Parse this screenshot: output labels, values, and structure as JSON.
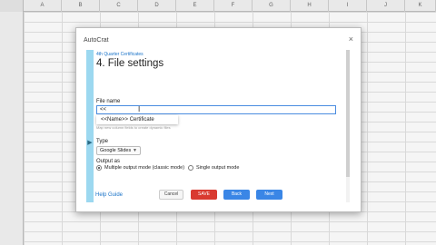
{
  "sheet": {
    "columns": [
      "A",
      "B",
      "C",
      "D",
      "E",
      "F",
      "G",
      "H",
      "I",
      "J",
      "K",
      "L"
    ]
  },
  "dialog": {
    "title": "AutoCrat",
    "close_glyph": "×",
    "breadcrumb": "4th Quarter Certificates",
    "heading": "4. File settings",
    "file_name_label": "File name",
    "file_name_value": "<<",
    "suggestion": "<<Name>> Certificate",
    "helper_text": "Map new column fields to create dynamic files",
    "type_label": "Type",
    "type_value": "Google Slides",
    "output_label": "Output as",
    "output_options": [
      {
        "label": "Multiple output mode (classic mode)",
        "selected": true
      },
      {
        "label": "Single output mode",
        "selected": false
      }
    ],
    "help_link": "Help Guide",
    "buttons": {
      "cancel": "Cancel",
      "save": "SAVE",
      "back": "Back",
      "next": "Next"
    }
  },
  "colors": {
    "sidebar": "#9cd8f0",
    "save": "#d93a30",
    "primary": "#3a86e6"
  }
}
